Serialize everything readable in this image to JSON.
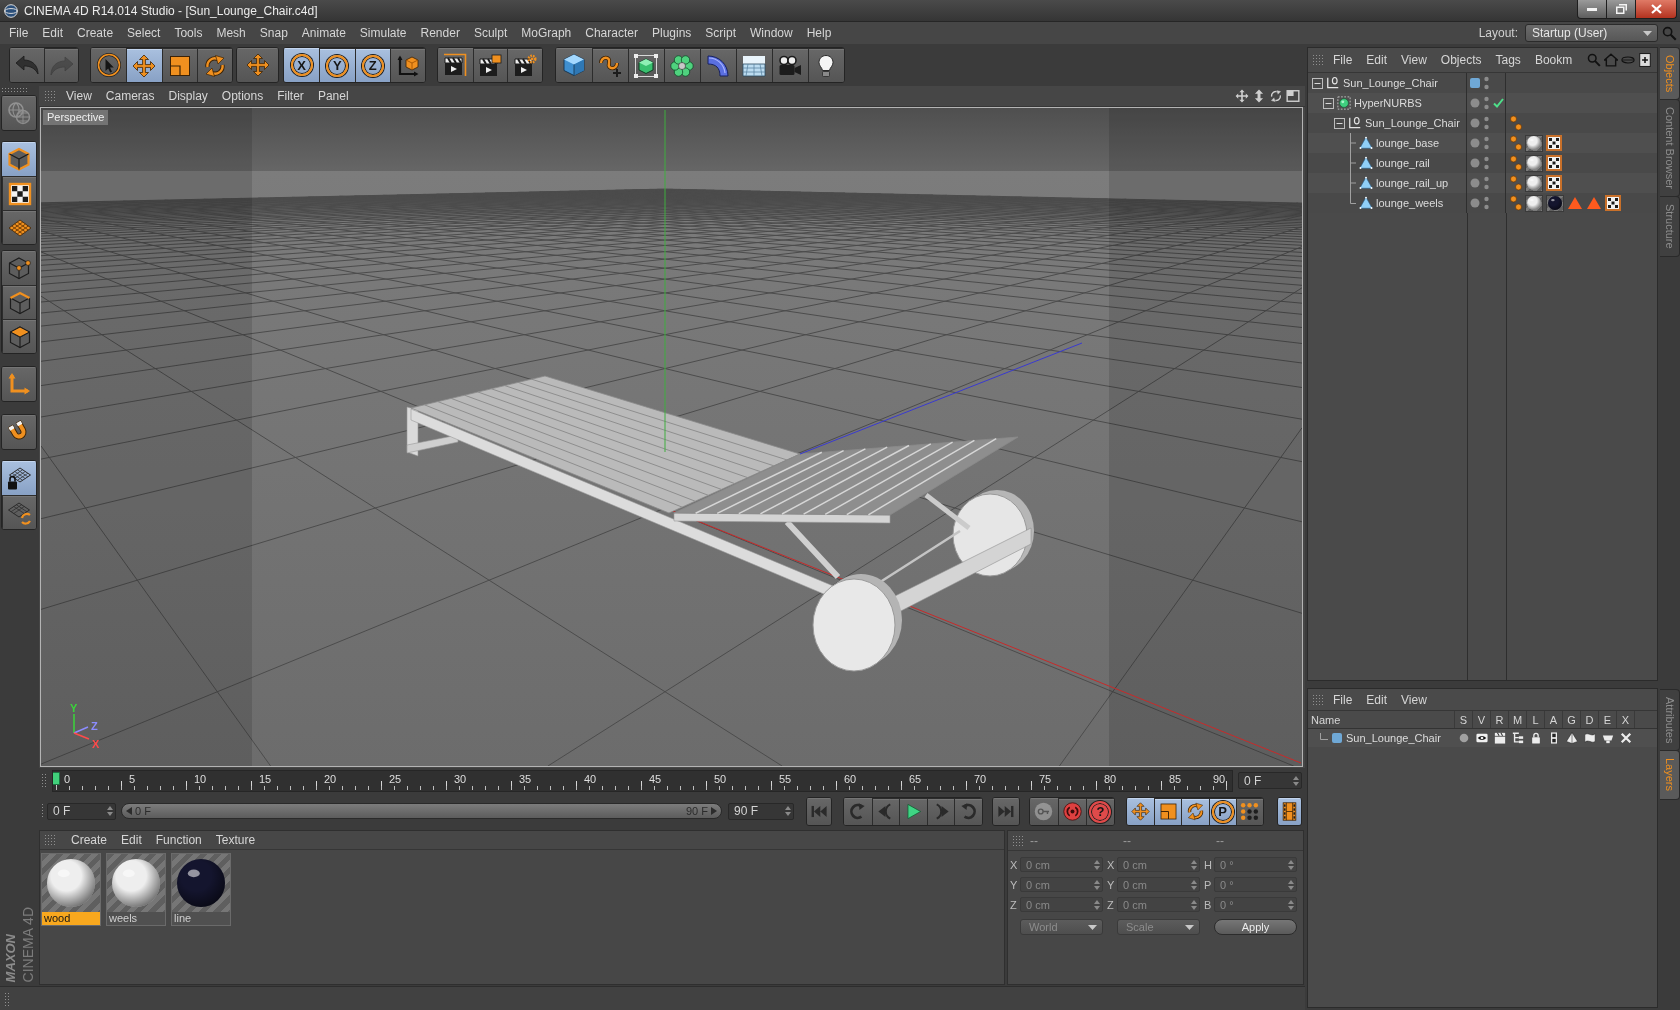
{
  "window": {
    "title": "CINEMA 4D R14.014 Studio - [Sun_Lounge_Chair.c4d]"
  },
  "menu_bar": {
    "items": [
      "File",
      "Edit",
      "Create",
      "Select",
      "Tools",
      "Mesh",
      "Snap",
      "Animate",
      "Simulate",
      "Render",
      "Sculpt",
      "MoGraph",
      "Character",
      "Plugins",
      "Script",
      "Window",
      "Help"
    ],
    "layout_label": "Layout:",
    "layout_value": "Startup (User)"
  },
  "toolbar": {
    "groups": [
      [
        {
          "kind": "undo",
          "selected": false,
          "disabled": false
        },
        {
          "kind": "redo",
          "selected": false,
          "disabled": true
        }
      ],
      [
        {
          "kind": "live_select",
          "selected": false
        },
        {
          "kind": "move",
          "selected": true
        },
        {
          "kind": "scale",
          "selected": false
        },
        {
          "kind": "rotate",
          "selected": false
        }
      ],
      [
        {
          "kind": "recent",
          "selected": false
        }
      ],
      [
        {
          "kind": "axis",
          "label": "X",
          "selected": true
        },
        {
          "kind": "axis",
          "label": "Y",
          "selected": true
        },
        {
          "kind": "axis",
          "label": "Z",
          "selected": true
        },
        {
          "kind": "coordinates",
          "selected": false
        }
      ],
      [
        {
          "kind": "render_view",
          "selected": false
        },
        {
          "kind": "render_picture",
          "selected": false
        },
        {
          "kind": "render_settings",
          "selected": false
        }
      ],
      [
        {
          "kind": "cube",
          "selected": false
        },
        {
          "kind": "spline",
          "selected": false
        },
        {
          "kind": "nurbs",
          "selected": false
        },
        {
          "kind": "cloner",
          "selected": false
        },
        {
          "kind": "deformer",
          "selected": false
        },
        {
          "kind": "floor",
          "selected": false
        },
        {
          "kind": "camera",
          "selected": false
        },
        {
          "kind": "light",
          "selected": false
        }
      ]
    ]
  },
  "mode_toolbar": {
    "groups": [
      [
        {
          "kind": "make_editable",
          "selected": false,
          "disabled": true
        }
      ],
      [
        {
          "kind": "model",
          "selected": true
        },
        {
          "kind": "texture",
          "selected": false
        },
        {
          "kind": "workplane",
          "selected": false
        }
      ],
      [
        {
          "kind": "points",
          "selected": false
        },
        {
          "kind": "edges",
          "selected": false
        },
        {
          "kind": "polygons",
          "selected": false
        }
      ],
      [
        {
          "kind": "axis_mode",
          "selected": false
        }
      ],
      [
        {
          "kind": "snap",
          "selected": false
        }
      ],
      [
        {
          "kind": "workplane_lock",
          "selected": true
        },
        {
          "kind": "workplane_align",
          "selected": false
        }
      ]
    ]
  },
  "viewport": {
    "menu": [
      "View",
      "Cameras",
      "Display",
      "Options",
      "Filter",
      "Panel"
    ],
    "camera": "Perspective",
    "gizmo": [
      {
        "label": "Y",
        "color": "#3ad43a"
      },
      {
        "label": "Z",
        "color": "#8c8cff"
      },
      {
        "label": "X",
        "color": "#ff4a4a"
      }
    ]
  },
  "timeline": {
    "ticks": [
      "0",
      "5",
      "10",
      "15",
      "20",
      "25",
      "30",
      "35",
      "40",
      "45",
      "50",
      "55",
      "60",
      "65",
      "70",
      "75",
      "80",
      "85",
      "90"
    ],
    "level": 0,
    "frame": "0 F"
  },
  "playback": {
    "start": "0 F",
    "range_start": "0 F",
    "range_end": "90 F",
    "end": "90 F",
    "groups": [
      [
        {
          "kind": "go_start",
          "selected": false
        }
      ],
      [
        {
          "kind": "prev_key",
          "selected": false
        },
        {
          "kind": "prev_frame",
          "selected": false
        },
        {
          "kind": "play",
          "selected": false
        },
        {
          "kind": "next_frame",
          "selected": false
        },
        {
          "kind": "next_key",
          "selected": false
        }
      ],
      [
        {
          "kind": "go_end",
          "selected": false
        }
      ],
      [
        {
          "kind": "record",
          "selected": false,
          "disabled": true
        },
        {
          "kind": "autokey",
          "selected": false,
          "disabled": false
        },
        {
          "kind": "help",
          "label": "?",
          "selected": false,
          "disabled": false
        }
      ],
      [
        {
          "kind": "position",
          "selected": true
        },
        {
          "kind": "scale",
          "selected": true
        },
        {
          "kind": "rotation",
          "selected": true
        },
        {
          "kind": "parameter",
          "label": "P",
          "selected": true
        },
        {
          "kind": "point_level",
          "selected": false
        }
      ],
      [
        {
          "kind": "timeline",
          "selected": true
        }
      ]
    ]
  },
  "materials": {
    "menu": [
      "Create",
      "Edit",
      "Function",
      "Texture"
    ],
    "items": [
      {
        "name": "wood",
        "color": "#eeeeee",
        "selected": true
      },
      {
        "name": "weels",
        "color": "#eeeeee",
        "selected": false
      },
      {
        "name": "line",
        "color": "#14152e",
        "selected": false
      }
    ]
  },
  "coordinates": {
    "headers": [
      "--",
      "--",
      "--"
    ],
    "rows": [
      [
        {
          "label": "X",
          "value": "0 cm"
        },
        {
          "label": "X",
          "value": "0 cm"
        },
        {
          "label": "H",
          "value": "0 °"
        }
      ],
      [
        {
          "label": "Y",
          "value": "0 cm"
        },
        {
          "label": "Y",
          "value": "0 cm"
        },
        {
          "label": "P",
          "value": "0 °"
        }
      ],
      [
        {
          "label": "Z",
          "value": "0 cm"
        },
        {
          "label": "Z",
          "value": "0 cm"
        },
        {
          "label": "B",
          "value": "0 °"
        }
      ]
    ],
    "dropdowns": [
      "World",
      "Scale"
    ],
    "apply": "Apply"
  },
  "objects": {
    "menu": [
      "File",
      "Edit",
      "View",
      "Objects",
      "Tags",
      "Bookm"
    ],
    "tree": [
      {
        "name": "Sun_Lounge_Chair",
        "kind": "null",
        "color": "#6fa8d6",
        "checked": false,
        "expanded": true,
        "children": [
          {
            "name": "HyperNURBS",
            "kind": "subdivision",
            "checked": true,
            "expanded": true,
            "children": [
              {
                "name": "Sun_Lounge_Chair",
                "kind": "null",
                "checked": false,
                "expanded": true,
                "tags": [
                  {
                    "kind": "phong"
                  }
                ],
                "children": [
                  {
                    "name": "lounge_base",
                    "kind": "polygon",
                    "checked": false,
                    "tags": [
                      {
                        "kind": "phong"
                      },
                      {
                        "kind": "material",
                        "color": "#eeeeee"
                      },
                      {
                        "kind": "uvw"
                      }
                    ]
                  },
                  {
                    "name": "lounge_rail",
                    "kind": "polygon",
                    "checked": false,
                    "tags": [
                      {
                        "kind": "phong"
                      },
                      {
                        "kind": "material",
                        "color": "#eeeeee"
                      },
                      {
                        "kind": "uvw"
                      }
                    ]
                  },
                  {
                    "name": "lounge_rail_up",
                    "kind": "polygon",
                    "checked": false,
                    "tags": [
                      {
                        "kind": "phong"
                      },
                      {
                        "kind": "material",
                        "color": "#eeeeee"
                      },
                      {
                        "kind": "uvw"
                      }
                    ]
                  },
                  {
                    "name": "lounge_weels",
                    "kind": "polygon",
                    "checked": false,
                    "tags": [
                      {
                        "kind": "phong"
                      },
                      {
                        "kind": "material",
                        "color": "#eeeeee"
                      },
                      {
                        "kind": "material",
                        "color": "#14152e"
                      },
                      {
                        "kind": "selection"
                      },
                      {
                        "kind": "selection"
                      },
                      {
                        "kind": "uvw"
                      }
                    ]
                  }
                ]
              }
            ]
          }
        ]
      }
    ]
  },
  "layers": {
    "menu": [
      "File",
      "Edit",
      "View"
    ],
    "columns": [
      "Name",
      "S",
      "V",
      "R",
      "M",
      "L",
      "A",
      "G",
      "D",
      "E",
      "X"
    ],
    "rows": [
      {
        "name": "Sun_Lounge_Chair",
        "color": "#6fa8d6",
        "switches": [
          {
            "on": false
          },
          {
            "on": true
          },
          {
            "on": true
          },
          {
            "on": true
          },
          {
            "on": true
          },
          {
            "on": true
          },
          {
            "on": true
          },
          {
            "on": true
          },
          {
            "on": true
          },
          {
            "on": true
          }
        ]
      }
    ]
  },
  "side_tabs": {
    "top": [
      {
        "label": "Objects",
        "selected": true
      },
      {
        "label": "Content Browser",
        "selected": false
      },
      {
        "label": "Structure",
        "selected": false
      }
    ],
    "bottom": [
      {
        "label": "Attributes",
        "selected": false
      },
      {
        "label": "Layers",
        "selected": true
      }
    ]
  },
  "logo": {
    "brand": "MAXON",
    "product": "CINEMA 4D"
  }
}
